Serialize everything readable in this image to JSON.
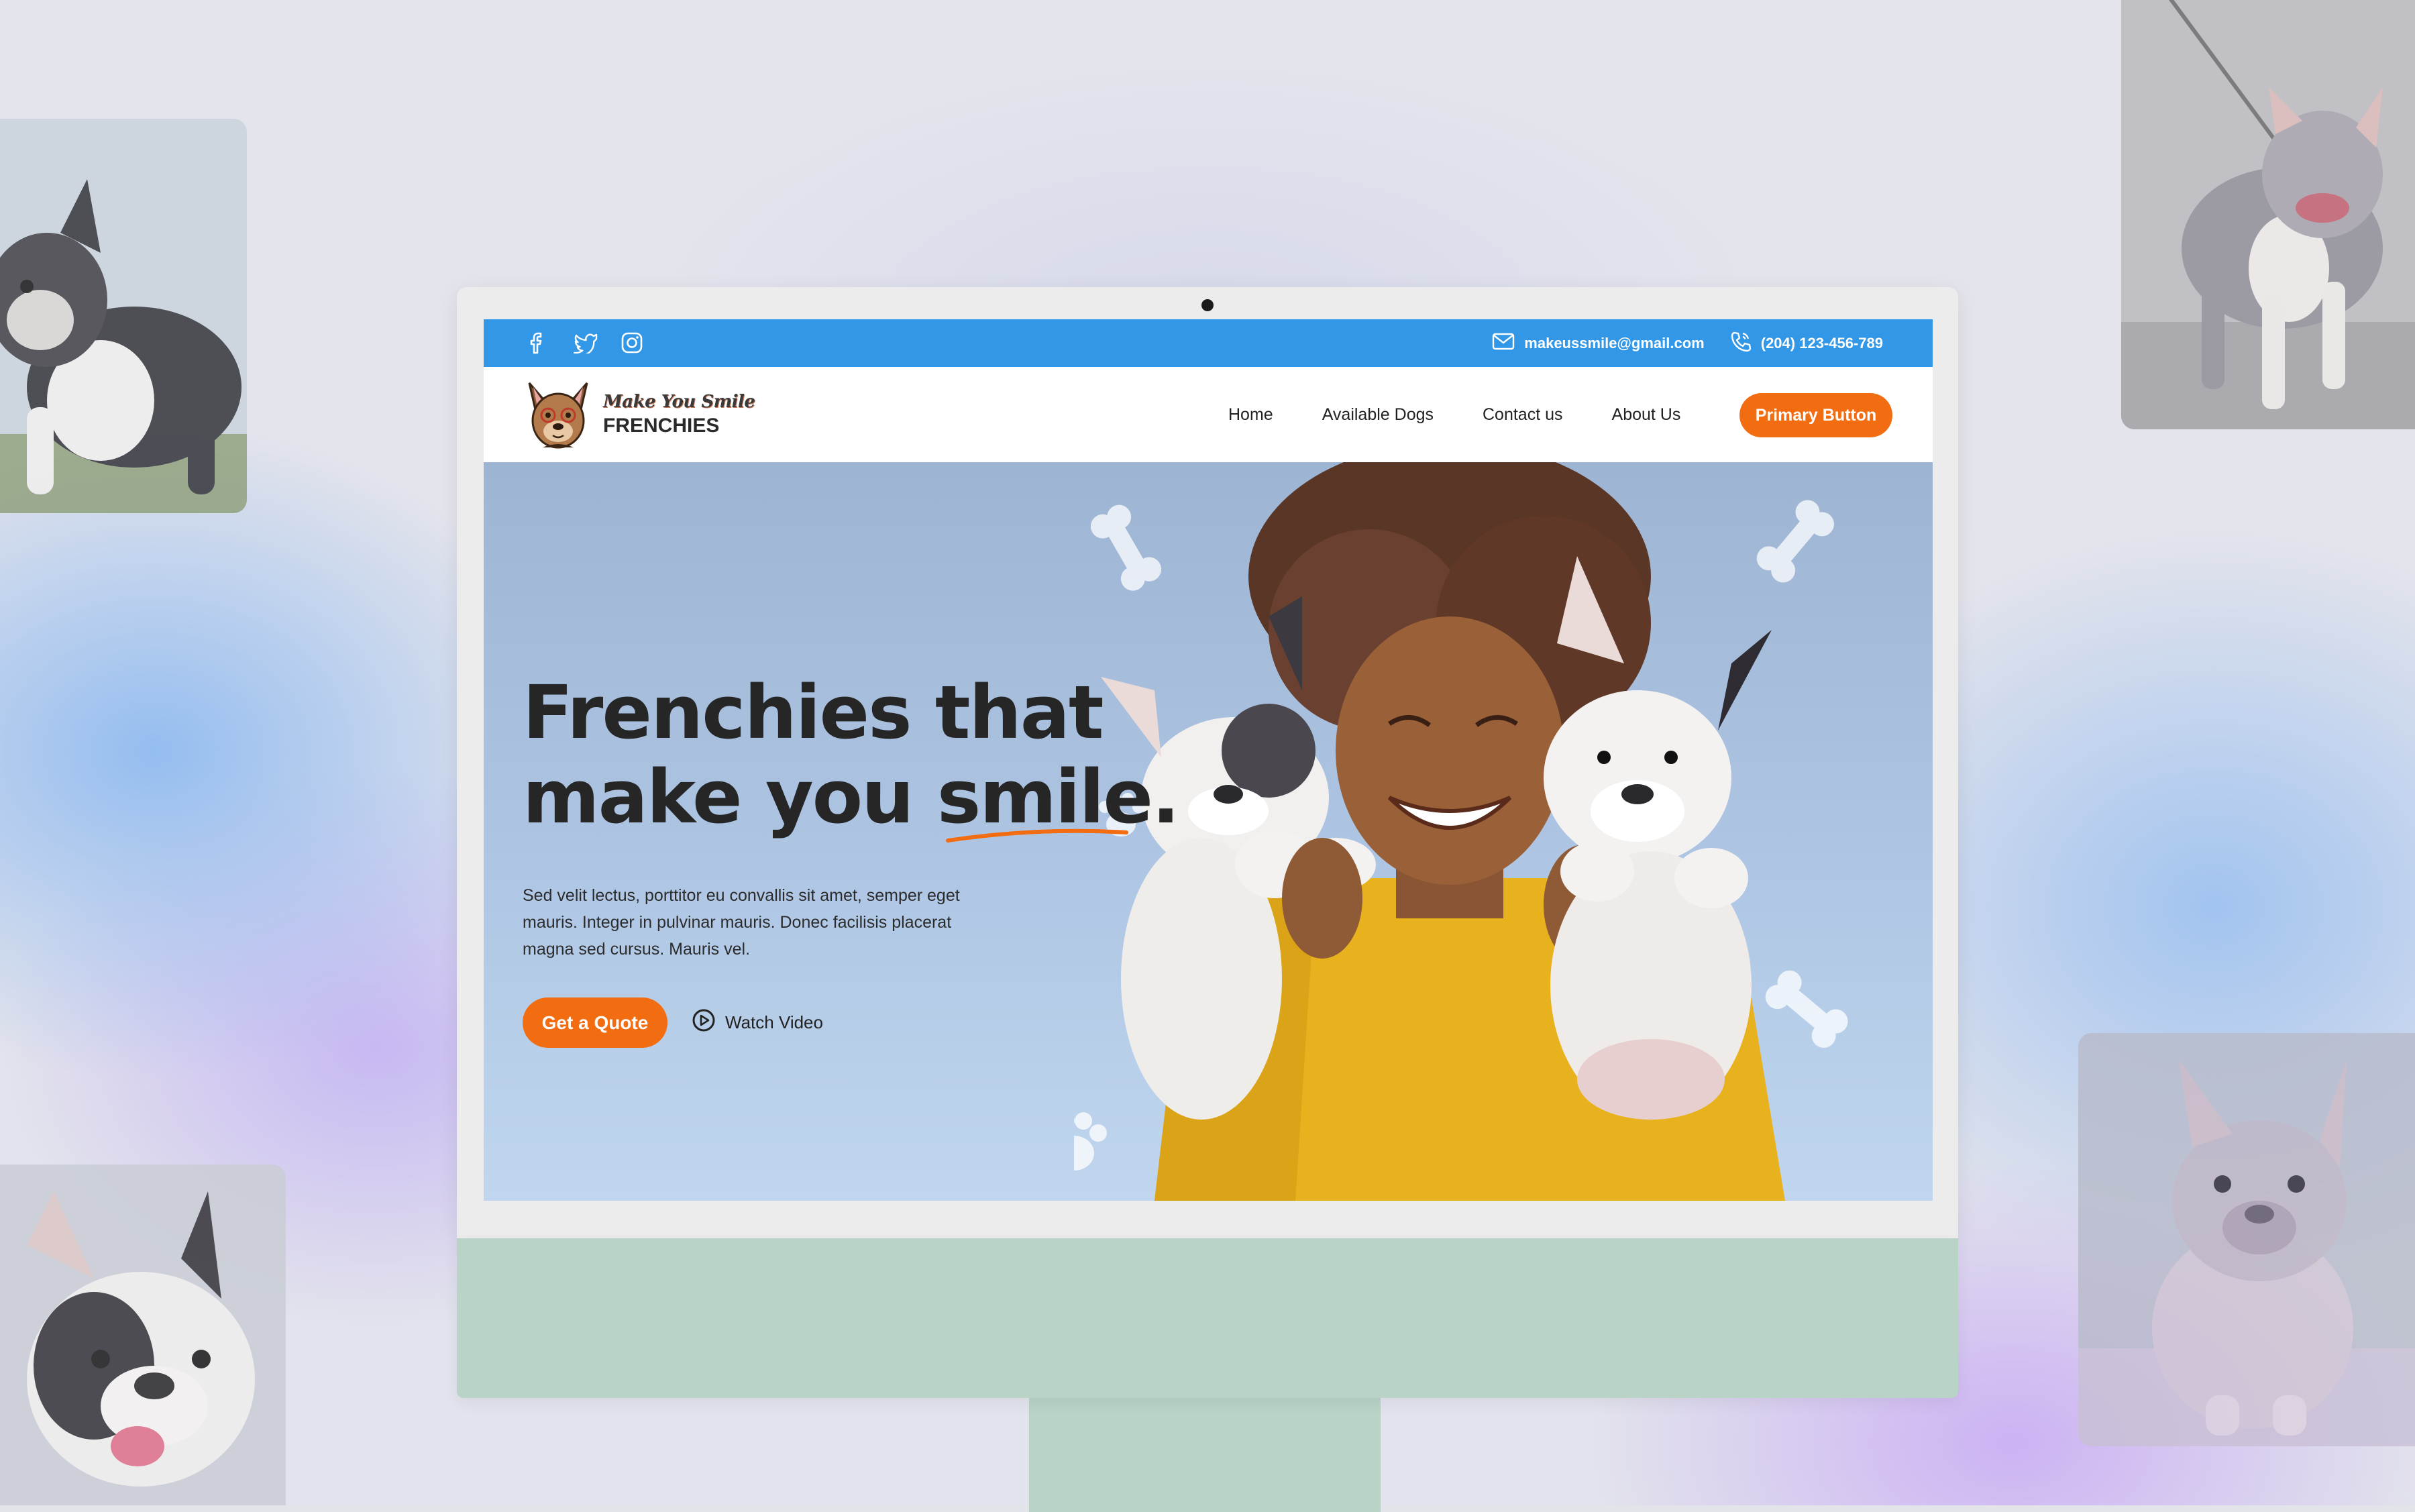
{
  "topbar": {
    "social_icons": [
      "facebook-icon",
      "twitter-icon",
      "instagram-icon"
    ],
    "email": "makeussmile@gmail.com",
    "phone": "(204) 123-456-789"
  },
  "brand": {
    "script": "Make You Smile",
    "name": "FRENCHIES"
  },
  "nav": {
    "items": [
      {
        "label": "Home"
      },
      {
        "label": "Available Dogs"
      },
      {
        "label": "Contact us"
      },
      {
        "label": "About Us"
      }
    ],
    "primary_button": "Primary Button"
  },
  "hero": {
    "title_line1": "Frenchies that",
    "title_line2_start": "make you ",
    "title_highlight": "smile",
    "title_end": ".",
    "description": "Sed velit lectus, porttitor eu convallis sit amet, semper eget mauris. Integer in pulvinar mauris. Donec facilisis placerat magna sed cursus. Mauris vel.",
    "quote_button": "Get a Quote",
    "video_button": "Watch Video"
  },
  "colors": {
    "topbar": "#3197e6",
    "accent": "#f26d12",
    "stand": "#b9d3c7"
  }
}
